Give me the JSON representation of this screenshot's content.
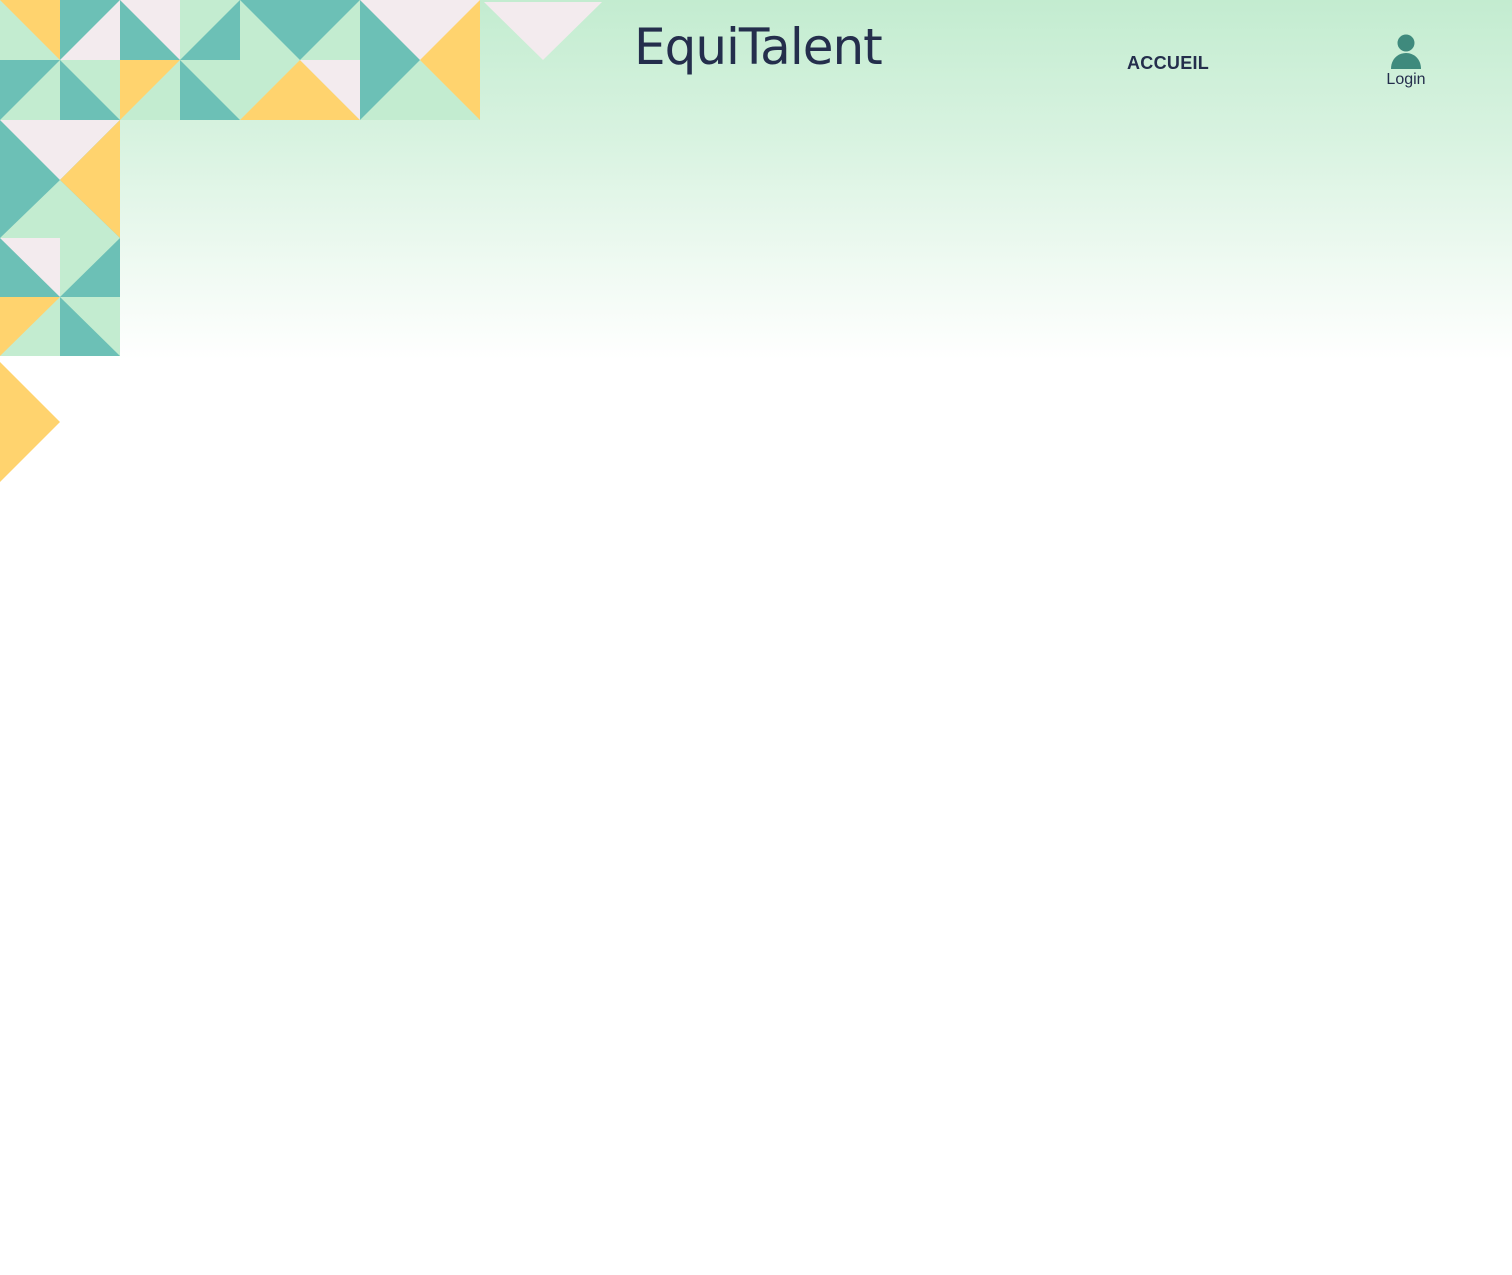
{
  "brand": {
    "logo_text": "EquiTalent"
  },
  "nav": {
    "home_label": "ACCUEIL"
  },
  "account": {
    "login_label": "Login",
    "icon": "user-icon"
  },
  "colors": {
    "teal": "#6cc0b6",
    "mint": "#c3ecd0",
    "yellow": "#ffd36e",
    "blush": "#f3ebee",
    "navy": "#242e4c",
    "icon_green": "#3f8a7d"
  }
}
